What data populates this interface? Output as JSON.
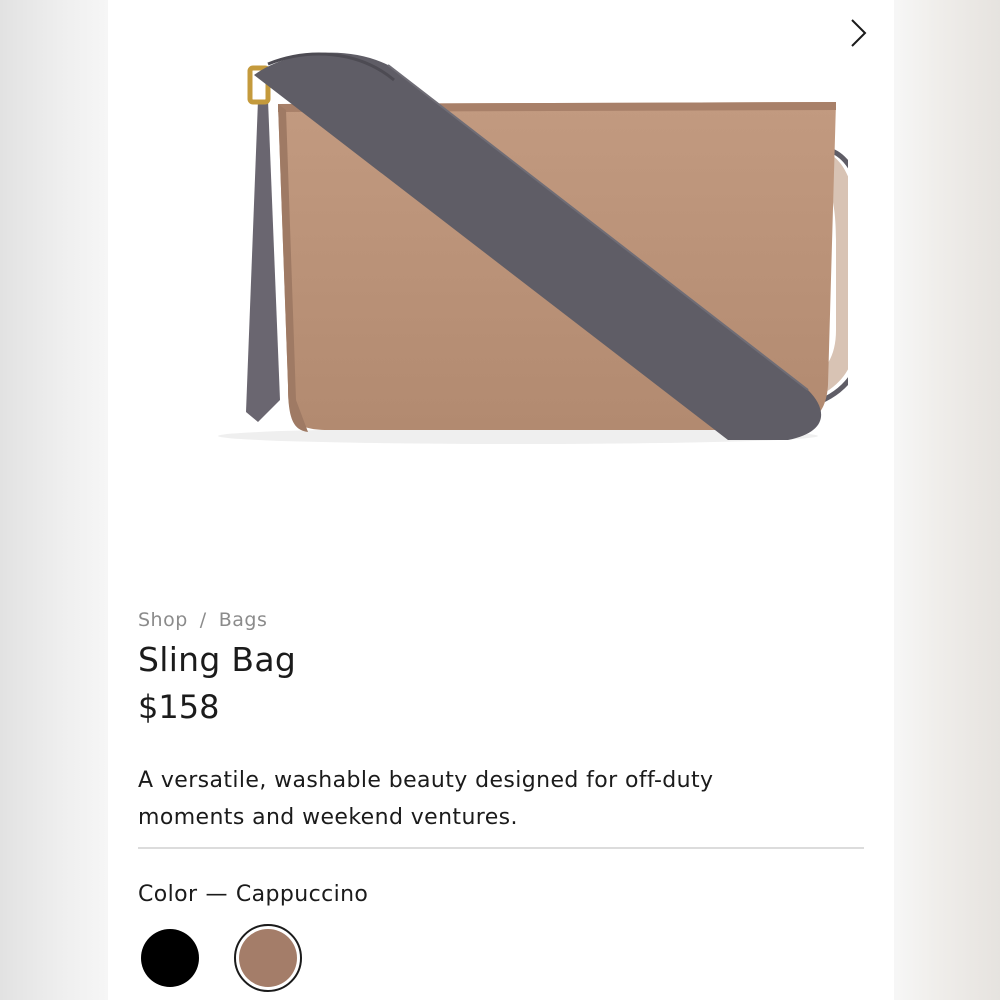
{
  "nav": {
    "next_icon": "chevron-right-icon"
  },
  "breadcrumb": {
    "items": [
      "Shop",
      "Bags"
    ],
    "separator": "/"
  },
  "product": {
    "title": "Sling Bag",
    "price": "$158",
    "description": "A versatile, washable beauty designed for off-duty moments and weekend ventures.",
    "image_alt": "sling-bag-product-photo"
  },
  "color": {
    "label": "Color",
    "separator": "—",
    "selected": "Cappuccino",
    "options": [
      {
        "name": "black",
        "hex": "#000000",
        "selected": false
      },
      {
        "name": "cappuccino",
        "hex": "#a47d69",
        "selected": true
      }
    ]
  },
  "colors": {
    "bag_body": "#b99177",
    "strap": "#5f5d66",
    "hardware": "#c49a3c",
    "text": "#1b1b1b",
    "muted": "#8b8b8b"
  }
}
